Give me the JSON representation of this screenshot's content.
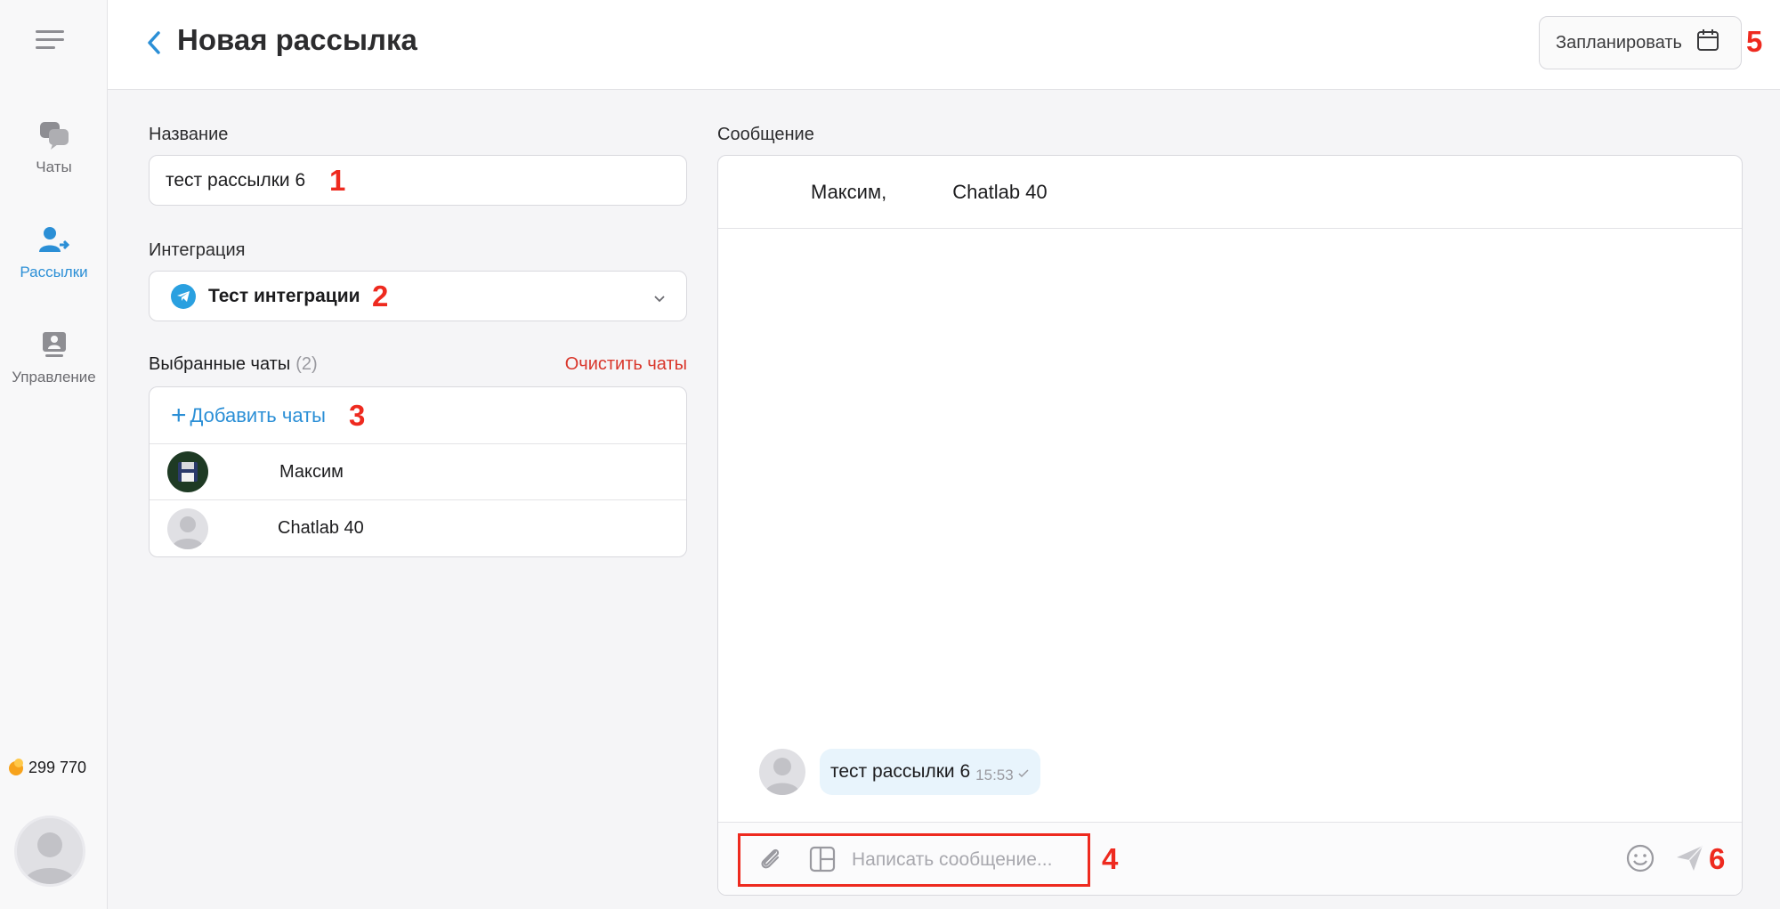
{
  "header": {
    "title": "Новая рассылка",
    "schedule_label": "Запланировать"
  },
  "sidebar": {
    "items": [
      {
        "label": "Чаты",
        "icon": "chats-icon"
      },
      {
        "label": "Рассылки",
        "icon": "broadcasts-icon"
      },
      {
        "label": "Управление",
        "icon": "management-icon"
      }
    ],
    "balance": "299 770"
  },
  "form": {
    "name_label": "Название",
    "name_value": "тест рассылки 6",
    "integration_label": "Интеграция",
    "integration_value": "Тест интеграции",
    "selected_chats_label": "Выбранные чаты",
    "selected_chats_count": "(2)",
    "clear_chats": "Очистить чаты",
    "add_chats": "Добавить чаты",
    "chats": [
      {
        "name": "Максим"
      },
      {
        "name": "Chatlab 40"
      }
    ]
  },
  "message": {
    "label": "Сообщение",
    "recipients": [
      "Максим,",
      "Chatlab 40"
    ],
    "bubble_text": "тест рассылки 6",
    "bubble_time": "15:53",
    "input_placeholder": "Написать сообщение..."
  },
  "annotations": [
    "1",
    "2",
    "3",
    "4",
    "5",
    "6"
  ],
  "colors": {
    "accent": "#2b8fd6",
    "danger": "#d9362b",
    "annotation": "#ee2a1f",
    "bubble": "#e8f4fc"
  }
}
